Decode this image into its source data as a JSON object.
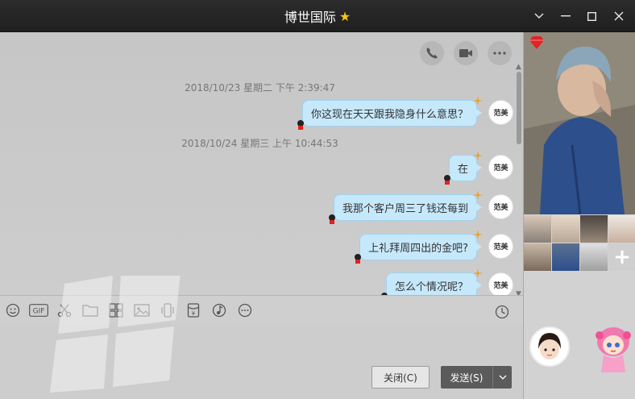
{
  "window": {
    "title": "博世国际",
    "colors": {
      "titlebar": "#232323",
      "bubble": "#c6e8fb",
      "send_button": "#5b5b5b",
      "star": "#f5c518"
    }
  },
  "call_tools": [
    {
      "name": "phone-icon"
    },
    {
      "name": "video-icon"
    },
    {
      "name": "more-icon"
    }
  ],
  "messages": [
    {
      "timestamp": "2018/10/23 星期二 下午 2:39:47",
      "text": "你这现在天天跟我隐身什么意思？",
      "avatar_text": "范美"
    },
    {
      "timestamp": "2018/10/24 星期三 上午 10:44:53",
      "text": "在",
      "avatar_text": "范美"
    },
    {
      "text": "我那个客户周三了钱还每到",
      "avatar_text": "范美"
    },
    {
      "text": "上礼拜周四出的金吧?",
      "avatar_text": "范美"
    },
    {
      "text": "怎么个情况呢？",
      "avatar_text": "范美"
    }
  ],
  "toolbar": {
    "items": [
      "emoji-icon",
      "gif-icon",
      "scissors-icon",
      "folder-icon",
      "gallery-icon",
      "image-icon",
      "shake-icon",
      "red-packet-icon",
      "music-icon",
      "more-icon"
    ],
    "gif_label": "GIF",
    "history_icon": "clock-icon"
  },
  "buttons": {
    "close_label": "关闭(C)",
    "send_label": "发送(S)"
  },
  "right_panel": {
    "add_label": "+"
  }
}
